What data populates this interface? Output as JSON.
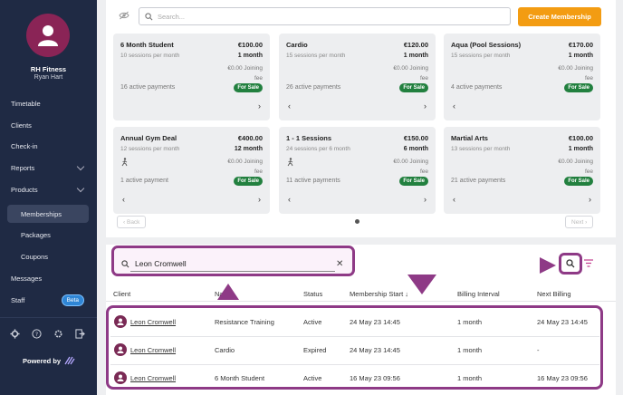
{
  "sidebar": {
    "org_name": "RH Fitness",
    "user_name": "Ryan Hart",
    "items": [
      {
        "label": "Timetable"
      },
      {
        "label": "Clients"
      },
      {
        "label": "Check-in"
      },
      {
        "label": "Reports"
      },
      {
        "label": "Products"
      },
      {
        "label": "Memberships"
      },
      {
        "label": "Packages"
      },
      {
        "label": "Coupons"
      },
      {
        "label": "Messages"
      },
      {
        "label": "Staff",
        "badge": "Beta"
      }
    ],
    "footer_icons": [
      "gear-icon",
      "help-icon",
      "settings-icon",
      "logout-icon"
    ],
    "powered_by": "Powered by"
  },
  "toolbar": {
    "search_placeholder": "Search...",
    "create_label": "Create Membership"
  },
  "cards": [
    {
      "name": "6 Month Student",
      "price": "€100.00",
      "sessions": "10 sessions per month",
      "period": "1 month",
      "joining1": "€0.00 Joining",
      "joining2": "fee",
      "payments": "16 active payments",
      "badge": "For Sale"
    },
    {
      "name": "Cardio",
      "price": "€120.00",
      "sessions": "15 sessions per month",
      "period": "1 month",
      "joining1": "€0.00 Joining",
      "joining2": "fee",
      "payments": "26 active payments",
      "badge": "For Sale"
    },
    {
      "name": "Aqua (Pool Sessions)",
      "price": "€170.00",
      "sessions": "15 sessions per month",
      "period": "1 month",
      "joining1": "€0.00 Joining",
      "joining2": "fee",
      "payments": "4 active payments",
      "badge": "For Sale"
    },
    {
      "name": "Annual Gym Deal",
      "price": "€400.00",
      "sessions": "12 sessions per month",
      "period": "12 month",
      "joining1": "€0.00 Joining",
      "joining2": "fee",
      "payments": "1 active payment",
      "badge": "For Sale"
    },
    {
      "name": "1 - 1 Sessions",
      "price": "€150.00",
      "sessions": "24 sessions per 6 month",
      "period": "6 month",
      "joining1": "€0.00 Joining",
      "joining2": "fee",
      "payments": "11 active payments",
      "badge": "For Sale"
    },
    {
      "name": "Martial Arts",
      "price": "€100.00",
      "sessions": "13 sessions per month",
      "period": "1 month",
      "joining1": "€0.00 Joining",
      "joining2": "fee",
      "payments": "21 active payments",
      "badge": "For Sale"
    }
  ],
  "pagination": {
    "back": "Back",
    "next": "Next"
  },
  "client_search": {
    "value": "Leon Cromwell"
  },
  "table": {
    "headers": [
      "Client",
      "Name",
      "Status",
      "Membership Start",
      "Billing Interval",
      "Next Billing"
    ],
    "rows": [
      {
        "client": "Leon Cromwell",
        "name": "Resistance Training",
        "status": "Active",
        "start": "24 May 23 14:45",
        "interval": "1 month",
        "next": "24 May 23 14:45"
      },
      {
        "client": "Leon Cromwell",
        "name": "Cardio",
        "status": "Expired",
        "start": "24 May 23 14:45",
        "interval": "1 month",
        "next": "-"
      },
      {
        "client": "Leon Cromwell",
        "name": "6 Month Student",
        "status": "Active",
        "start": "16 May 23 09:56",
        "interval": "1 month",
        "next": "16 May 23 09:56"
      }
    ]
  },
  "colors": {
    "accent": "#f39c12",
    "sale": "#22803f",
    "highlight": "#8e3a86",
    "sidebar": "#1f2a44"
  }
}
